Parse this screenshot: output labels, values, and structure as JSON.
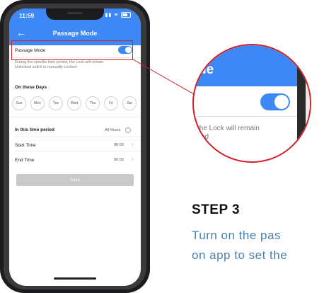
{
  "status_bar": {
    "time": "11:59"
  },
  "app": {
    "title": "Passage Mode",
    "back_icon": "arrow-left-icon",
    "passage_mode_label": "Passage Mode",
    "passage_mode_on": true,
    "description_line1": "During the specific time period, the Lock will remain",
    "description_line2": "Unlocked until it is manually Locked",
    "days_title": "On these Days",
    "days": [
      "Sun",
      "Mon",
      "Tue",
      "Wed",
      "Thu",
      "Fri",
      "Sat"
    ],
    "period_title": "In this time period",
    "period_value": "All Hours",
    "start_time_label": "Start Time",
    "start_time_value": "00:00",
    "end_time_label": "End Time",
    "end_time_value": "00:00",
    "save_label": "Save"
  },
  "zoom": {
    "title_fragment": "de",
    "desc_line1": "the Lock will remain",
    "desc_line2": "ked"
  },
  "step": {
    "title": "STEP 3",
    "line1": "Turn on the pas",
    "line2": "on app to set the"
  },
  "colors": {
    "accent": "#3d88f4",
    "highlight": "#d0202a",
    "body_text": "#4a7fb0"
  }
}
